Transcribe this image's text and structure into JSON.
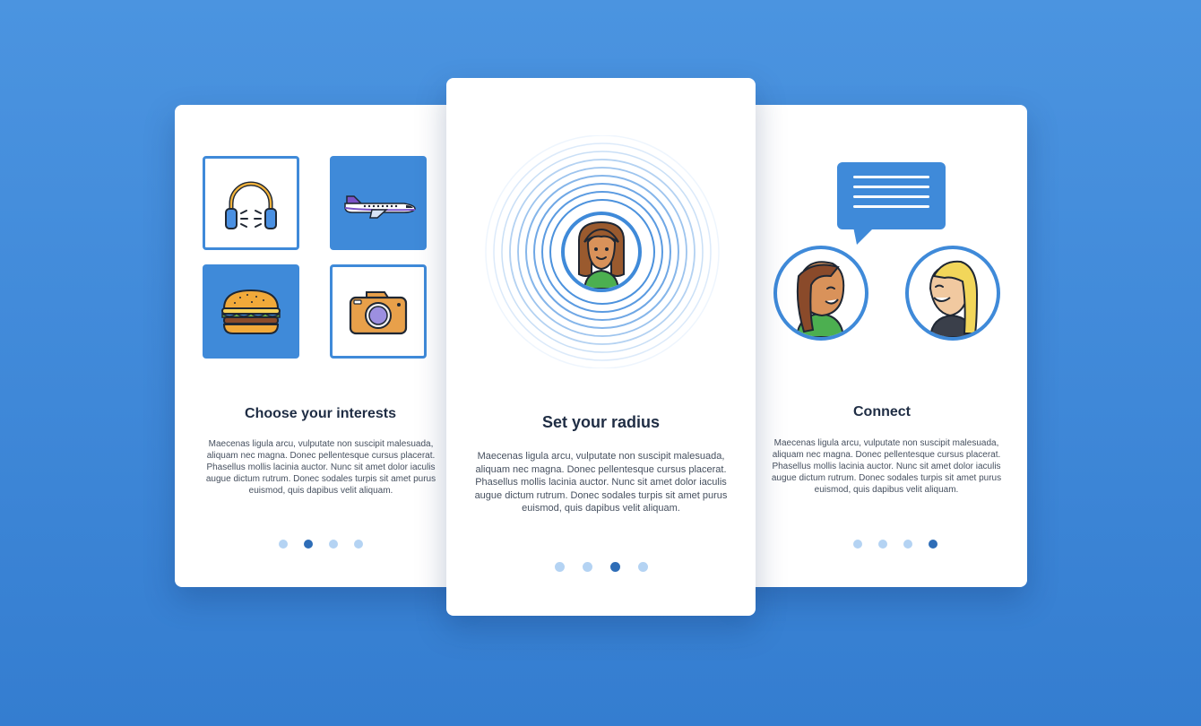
{
  "cards": [
    {
      "title": "Choose your interests",
      "body": "Maecenas ligula arcu, vulputate non suscipit malesuada, aliquam nec magna. Donec pellentesque cursus placerat. Phasellus mollis lacinia auctor. Nunc sit amet dolor iaculis augue dictum rutrum. Donec sodales turpis sit amet purus euismod, quis dapibus velit aliquam.",
      "interests": [
        "headphones-icon",
        "airplane-icon",
        "burger-icon",
        "camera-icon"
      ],
      "dots_total": 4,
      "active_dot": 2
    },
    {
      "title": "Set your radius",
      "body": "Maecenas ligula arcu, vulputate non suscipit malesuada, aliquam nec magna. Donec pellentesque cursus placerat. Phasellus mollis lacinia auctor. Nunc sit amet dolor iaculis augue dictum rutrum. Donec sodales turpis sit amet purus euismod, quis dapibus velit aliquam.",
      "icon": "radius-rings-avatar",
      "dots_total": 4,
      "active_dot": 3
    },
    {
      "title": "Connect",
      "body": "Maecenas ligula arcu, vulputate non suscipit malesuada, aliquam nec magna. Donec pellentesque cursus placerat. Phasellus mollis lacinia auctor. Nunc sit amet dolor iaculis augue dictum rutrum. Donec sodales turpis sit amet purus euismod, quis dapibus velit aliquam.",
      "icons": [
        "chat-bubble-icon",
        "avatar-brunette",
        "avatar-blonde"
      ],
      "dots_total": 4,
      "active_dot": 4
    }
  ],
  "colors": {
    "background_top": "#4b94e0",
    "background_bottom": "#347dd0",
    "accent": "#3f8ad9",
    "dot_inactive": "#b4d3f3",
    "dot_active": "#2e6db7",
    "title": "#1f2d44"
  }
}
